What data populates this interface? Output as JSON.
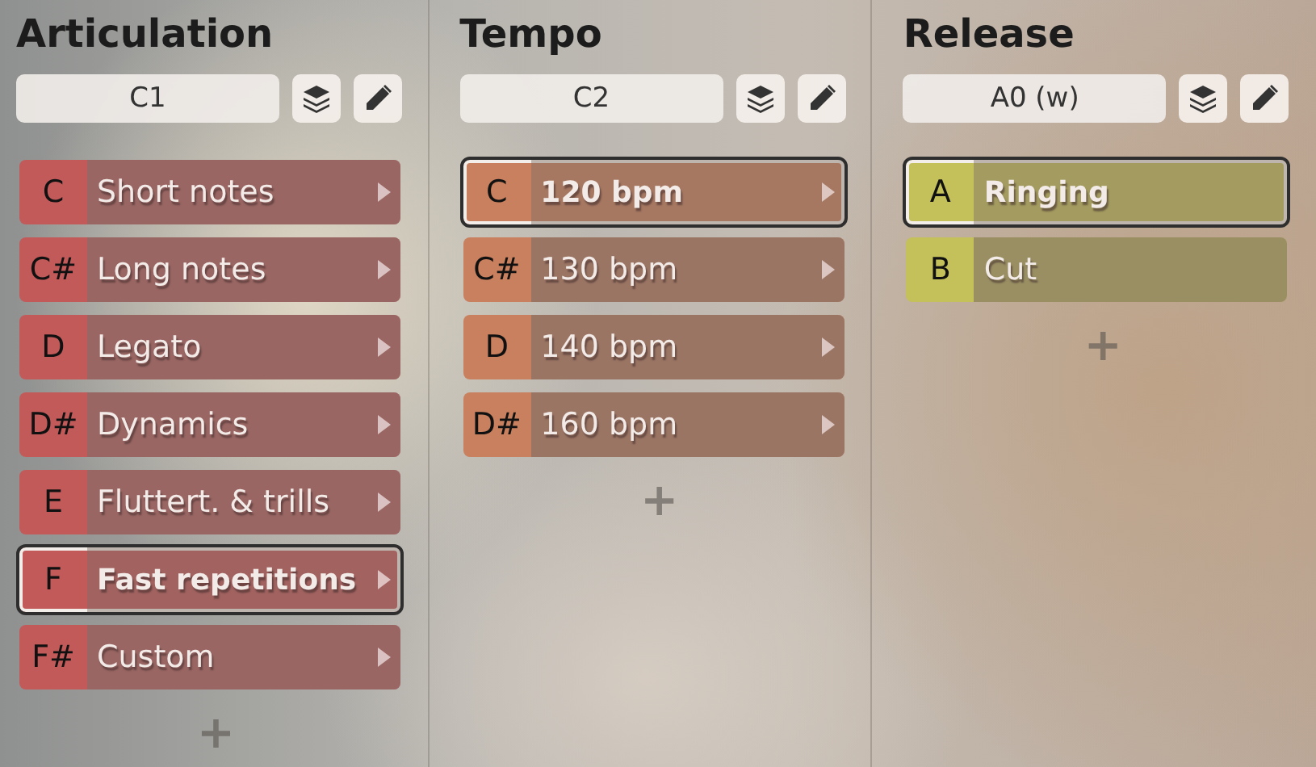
{
  "columns": [
    {
      "title": "Articulation",
      "field": "C1",
      "color": "#c25a5a",
      "expandable": true,
      "add": "+",
      "rows": [
        {
          "key": "C",
          "label": "Short notes",
          "selected": false
        },
        {
          "key": "C#",
          "label": "Long notes",
          "selected": false
        },
        {
          "key": "D",
          "label": "Legato",
          "selected": false
        },
        {
          "key": "D#",
          "label": "Dynamics",
          "selected": false
        },
        {
          "key": "E",
          "label": "Fluttert. & trills",
          "selected": false
        },
        {
          "key": "F",
          "label": "Fast repetitions",
          "selected": true
        },
        {
          "key": "F#",
          "label": "Custom",
          "selected": false
        }
      ]
    },
    {
      "title": "Tempo",
      "field": "C2",
      "color": "#c9805e",
      "expandable": true,
      "add": "+",
      "rows": [
        {
          "key": "C",
          "label": "120 bpm",
          "selected": true
        },
        {
          "key": "C#",
          "label": "130 bpm",
          "selected": false
        },
        {
          "key": "D",
          "label": "140 bpm",
          "selected": false
        },
        {
          "key": "D#",
          "label": "160 bpm",
          "selected": false
        }
      ]
    },
    {
      "title": "Release",
      "field": "A0 (w)",
      "color": "#c4c05a",
      "expandable": false,
      "add": "+",
      "rows": [
        {
          "key": "A",
          "label": "Ringing",
          "selected": true
        },
        {
          "key": "B",
          "label": "Cut",
          "selected": false
        }
      ]
    }
  ]
}
